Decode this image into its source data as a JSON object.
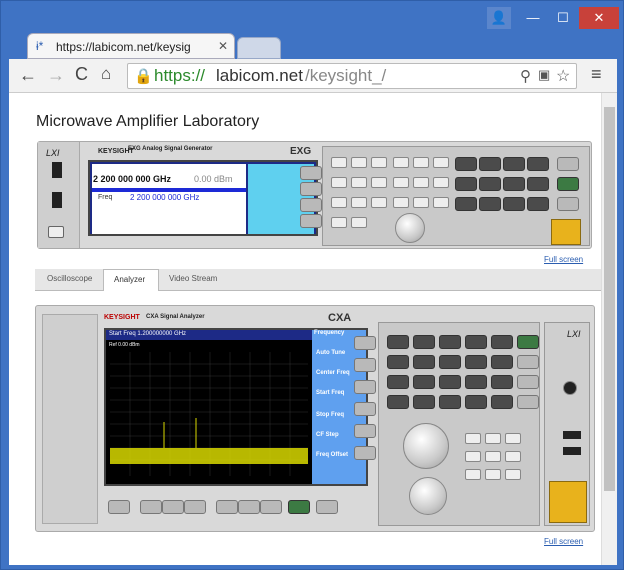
{
  "browser": {
    "tab_title": "https://labicom.net/keysig",
    "url_prefix": "https://",
    "url_domain": "labicom.net",
    "url_path": "/keysight_/"
  },
  "page": {
    "title": "Microwave Amplifier Laboratory",
    "fullscreen_1": "Full screen",
    "fullscreen_2": "Full screen"
  },
  "exg": {
    "brand": "KEYSIGHT",
    "model": "EXG Analog Signal Generator",
    "tag": "EXG",
    "lxi": "LXI",
    "freq": "2 200 000 000 GHz",
    "amp": "0.00 dBm",
    "freq_line": "2 200 000 000 GHz",
    "freq_label": "Freq"
  },
  "tabs": [
    "Oscilloscope",
    "Analyzer",
    "Video Stream"
  ],
  "active_tab": "Analyzer",
  "cxa": {
    "brand": "KEYSIGHT",
    "model": "CXA Signal Analyzer",
    "tag": "CXA",
    "lxi": "LXI",
    "start_freq": "Start Freq 1.200000000 GHz",
    "ref": "Ref 0.00 dBm",
    "softkeys": [
      "Frequency",
      "Auto Tune",
      "Center Freq",
      "Start Freq",
      "Stop Freq",
      "CF Step",
      "Freq Offset"
    ]
  }
}
